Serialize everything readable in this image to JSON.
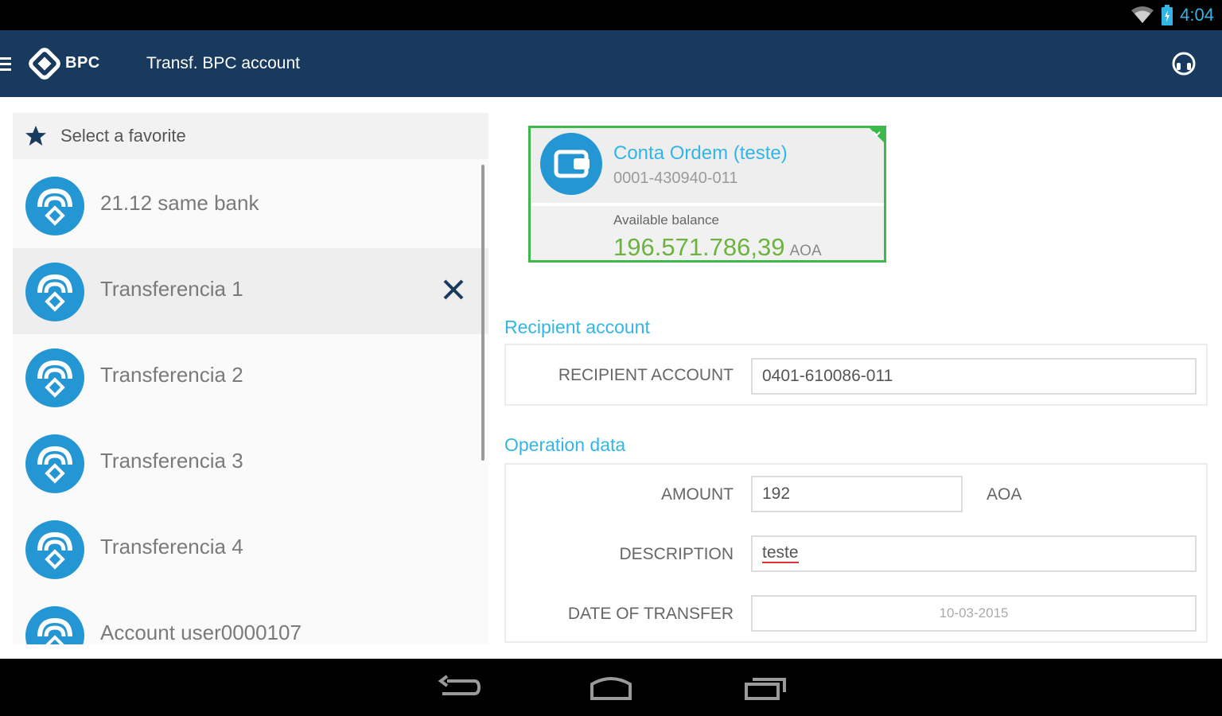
{
  "status_bar": {
    "time": "4:04",
    "icons": [
      "wifi-icon",
      "battery-icon"
    ]
  },
  "app_bar": {
    "logo_text": "BPC",
    "title": "Transf. BPC account",
    "icons": [
      "menu-icon",
      "bpc-logo-icon",
      "support-icon"
    ]
  },
  "favorites": {
    "header": "Select a favorite",
    "items": [
      {
        "label": "21.12 same bank"
      },
      {
        "label": "Transferencia 1"
      },
      {
        "label": "Transferencia 2"
      },
      {
        "label": "Transferencia 3"
      },
      {
        "label": "Transferencia 4"
      },
      {
        "label": "Account user0000107"
      }
    ]
  },
  "account_card": {
    "name": "Conta Ordem (teste)",
    "number": "0001-430940-011",
    "balance_label": "Available balance",
    "balance": "196.571.786,39",
    "currency": "AOA"
  },
  "recipient": {
    "section_title": "Recipient account",
    "label": "RECIPIENT ACCOUNT",
    "value": "0401-610086-011"
  },
  "operation": {
    "section_title": "Operation data",
    "amount_label": "AMOUNT",
    "amount_value": "192",
    "amount_currency": "AOA",
    "description_label": "DESCRIPTION",
    "description_value": "teste",
    "date_label": "DATE OF TRANSFER",
    "date_value": "10-03-2015"
  },
  "colors": {
    "app_bar": "#173a5e",
    "accent": "#33b5e5",
    "balance": "#6db33f",
    "card_border": "#3db84a"
  }
}
